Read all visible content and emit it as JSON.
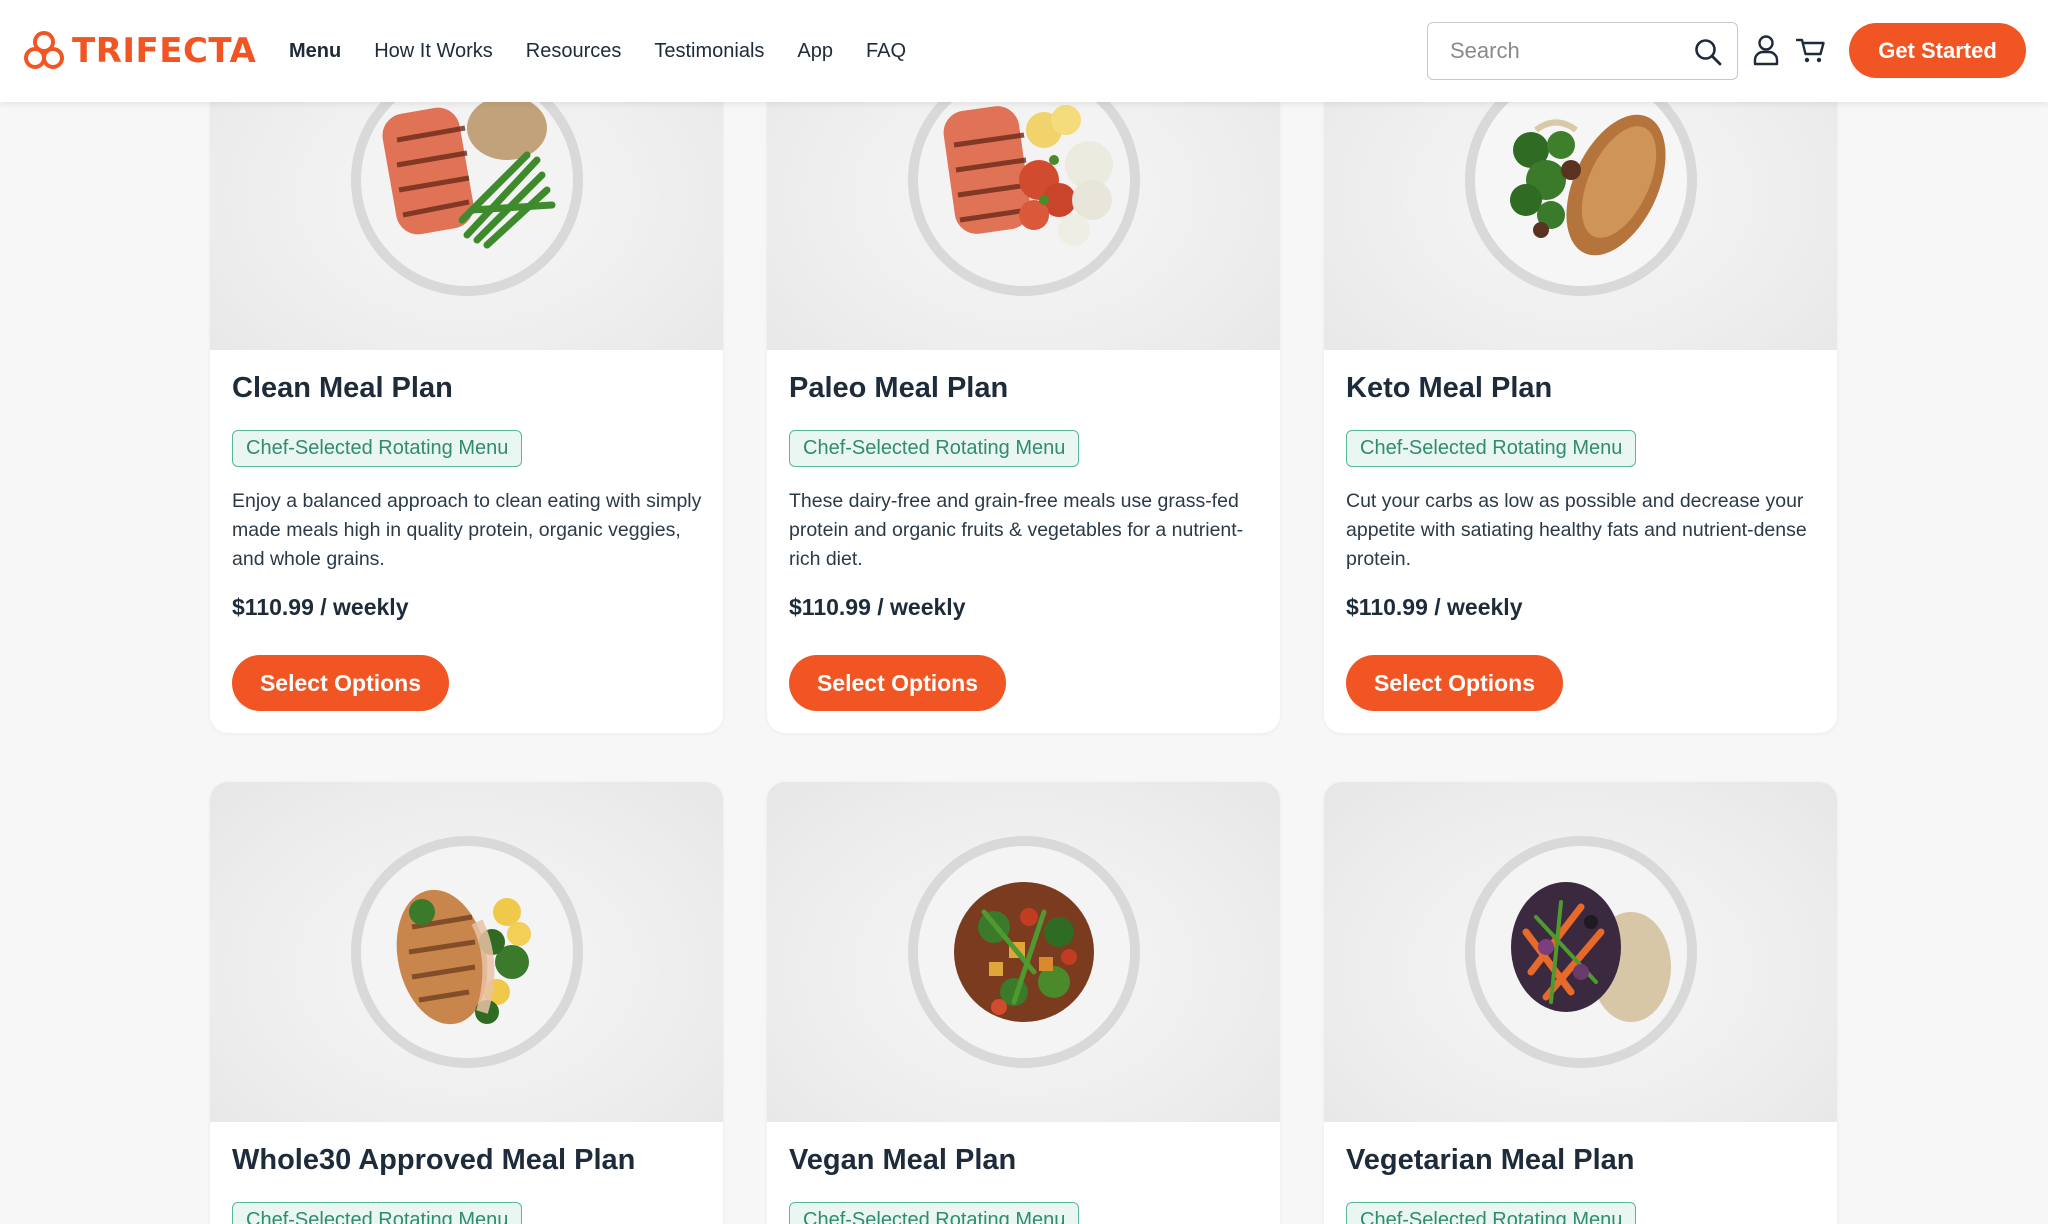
{
  "brand": {
    "name": "TRIFECTA",
    "accent": "#f05523",
    "badge_color": "#2f8c6e"
  },
  "nav": {
    "items": [
      {
        "label": "Menu",
        "active": true
      },
      {
        "label": "How It Works"
      },
      {
        "label": "Resources"
      },
      {
        "label": "Testimonials"
      },
      {
        "label": "App"
      },
      {
        "label": "FAQ"
      }
    ]
  },
  "search": {
    "placeholder": "Search",
    "icon": "search-icon"
  },
  "header_icons": {
    "account": "user-icon",
    "cart": "cart-icon"
  },
  "cta": {
    "label": "Get Started"
  },
  "cards": [
    {
      "title": "Clean Meal Plan",
      "badge": "Chef-Selected Rotating Menu",
      "description": "Enjoy a balanced approach to clean eating with simply made meals high in quality protein, organic veggies, and whole grains.",
      "price": "$110.99 / weekly",
      "button": "Select Options"
    },
    {
      "title": "Paleo Meal Plan",
      "badge": "Chef-Selected Rotating Menu",
      "description": "These dairy-free and grain-free meals use grass-fed protein and organic fruits & vegetables for a nutrient-rich diet.",
      "price": "$110.99 / weekly",
      "button": "Select Options"
    },
    {
      "title": "Keto Meal Plan",
      "badge": "Chef-Selected Rotating Menu",
      "description": "Cut your carbs as low as possible and decrease your appetite with satiating healthy fats and nutrient-dense protein.",
      "price": "$110.99 / weekly",
      "button": "Select Options"
    },
    {
      "title": "Whole30 Approved Meal Plan",
      "badge": "Chef-Selected Rotating Menu"
    },
    {
      "title": "Vegan Meal Plan",
      "badge": "Chef-Selected Rotating Menu"
    },
    {
      "title": "Vegetarian Meal Plan",
      "badge": "Chef-Selected Rotating Menu"
    }
  ]
}
